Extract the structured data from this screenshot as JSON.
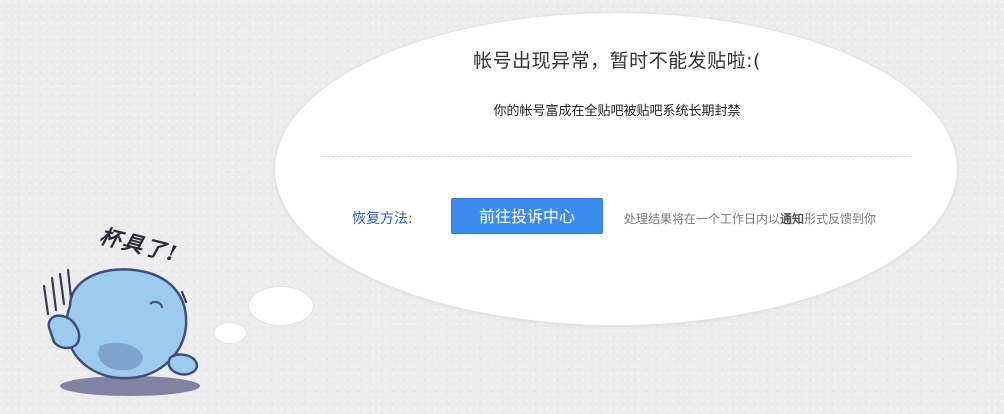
{
  "message": {
    "title": "帐号出现异常，暂时不能发贴啦:(",
    "subtitle": "你的帐号富成在全贴吧被贴吧系统长期封禁"
  },
  "recovery": {
    "label": "恢复方法:",
    "button_label": "前往投诉中心",
    "note_before": "处理结果将在一个工作日内以",
    "note_emphasis": "通知",
    "note_after": "形式反馈到你"
  },
  "mascot": {
    "caption": "杯具了!",
    "icon": "crying-mascot-icon"
  },
  "colors": {
    "button": "#3c8cf0",
    "label": "#2c5ea8",
    "background": "#ececec",
    "mascot_body": "#9dcbef"
  }
}
